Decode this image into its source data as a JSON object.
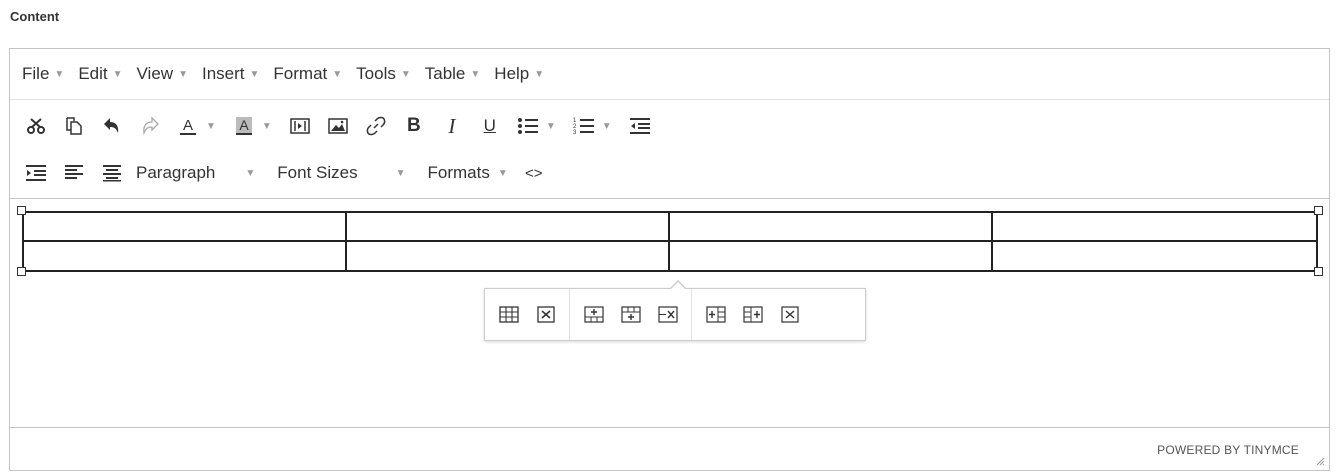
{
  "field": {
    "label": "Content"
  },
  "menubar": [
    {
      "label": "File"
    },
    {
      "label": "Edit"
    },
    {
      "label": "View"
    },
    {
      "label": "Insert"
    },
    {
      "label": "Format"
    },
    {
      "label": "Tools"
    },
    {
      "label": "Table"
    },
    {
      "label": "Help"
    }
  ],
  "toolbar": {
    "row1": [
      "cut-icon",
      "copy-icon",
      "undo-icon",
      "redo-icon",
      "text-color-icon",
      "background-color-icon",
      "media-icon",
      "image-icon",
      "link-icon",
      "bold-icon",
      "italic-icon",
      "underline-icon",
      "bullet-list-icon",
      "numbered-list-icon",
      "outdent-icon"
    ],
    "row2_icons": [
      "indent-icon",
      "align-left-icon",
      "align-center-icon",
      "code-icon"
    ],
    "bold_glyph": "B",
    "italic_glyph": "I",
    "underline_glyph": "U",
    "code_glyph": "<>",
    "block_format": "Paragraph",
    "font_sizes": "Font Sizes",
    "formats": "Formats"
  },
  "table": {
    "rows": 2,
    "cols": 4
  },
  "context_toolbar": {
    "groups": [
      [
        "table-properties-icon",
        "delete-table-icon"
      ],
      [
        "insert-row-before-icon",
        "insert-row-after-icon",
        "delete-row-icon"
      ],
      [
        "insert-column-before-icon",
        "insert-column-after-icon",
        "delete-column-icon"
      ]
    ]
  },
  "statusbar": {
    "powered_by": "POWERED BY TINYMCE"
  }
}
